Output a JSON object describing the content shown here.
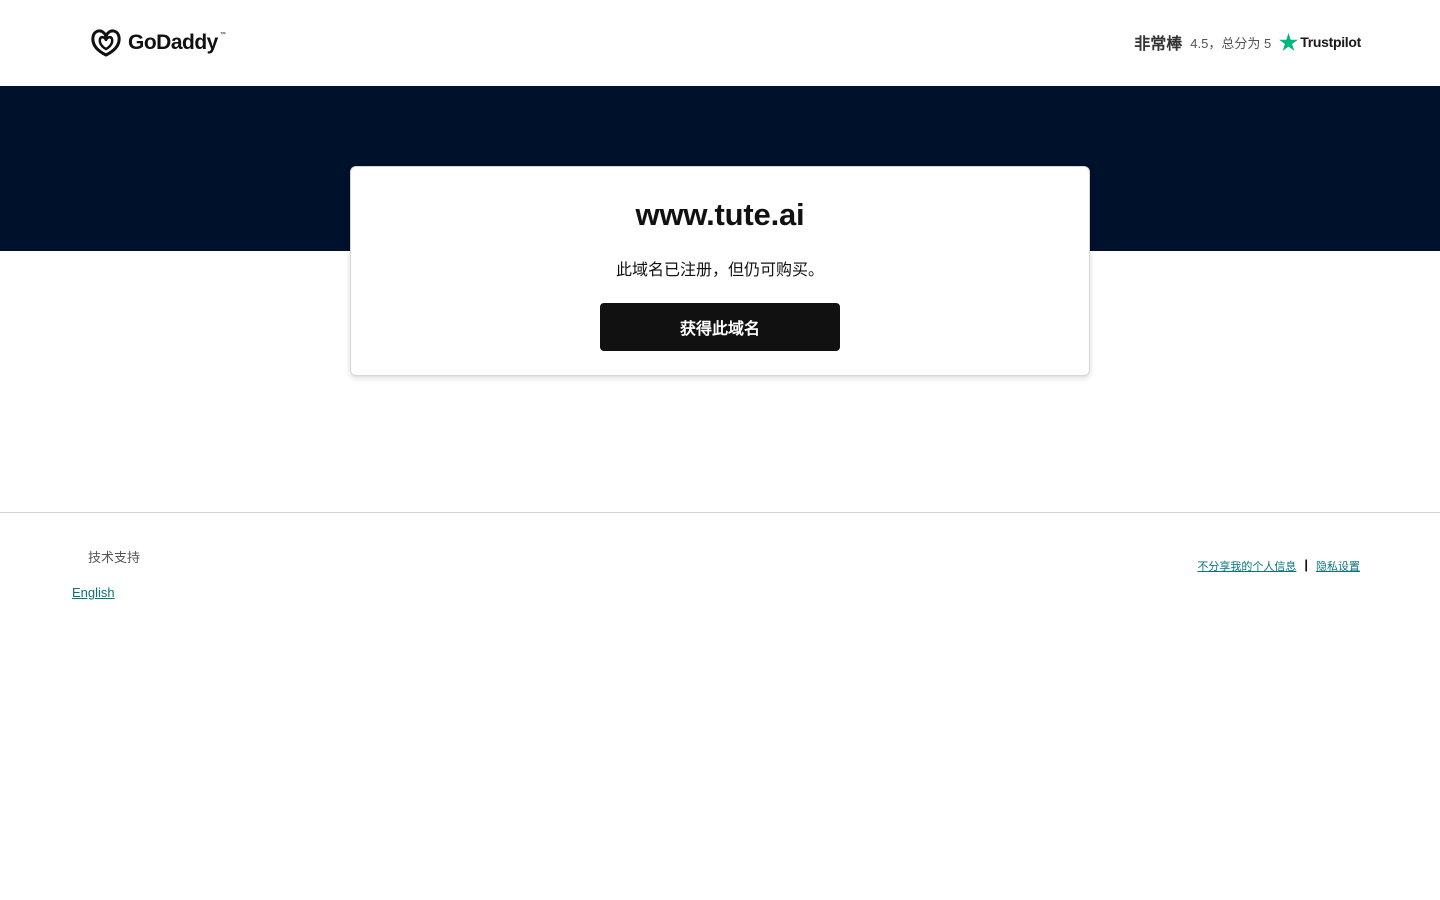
{
  "header": {
    "logo_text": "GoDaddy",
    "logo_tm": "™",
    "rating": {
      "word": "非常棒",
      "score_text": "4.5，总分为 5",
      "provider": "Trustpilot"
    }
  },
  "card": {
    "domain": "www.tute.ai",
    "subtitle": "此域名已注册，但仍可购买。",
    "cta_label": "获得此域名"
  },
  "footer": {
    "support_label": "技术支持",
    "language_label": "English",
    "privacy_optout_label": "不分享我的个人信息",
    "separator": "|",
    "privacy_settings_label": "隐私设置"
  },
  "colors": {
    "band": "#00112c",
    "cta_bg": "#111111",
    "link": "#09757a",
    "trustpilot_green": "#00b67a"
  },
  "icons": [
    "godaddy-logo-icon",
    "trustpilot-star-icon"
  ]
}
